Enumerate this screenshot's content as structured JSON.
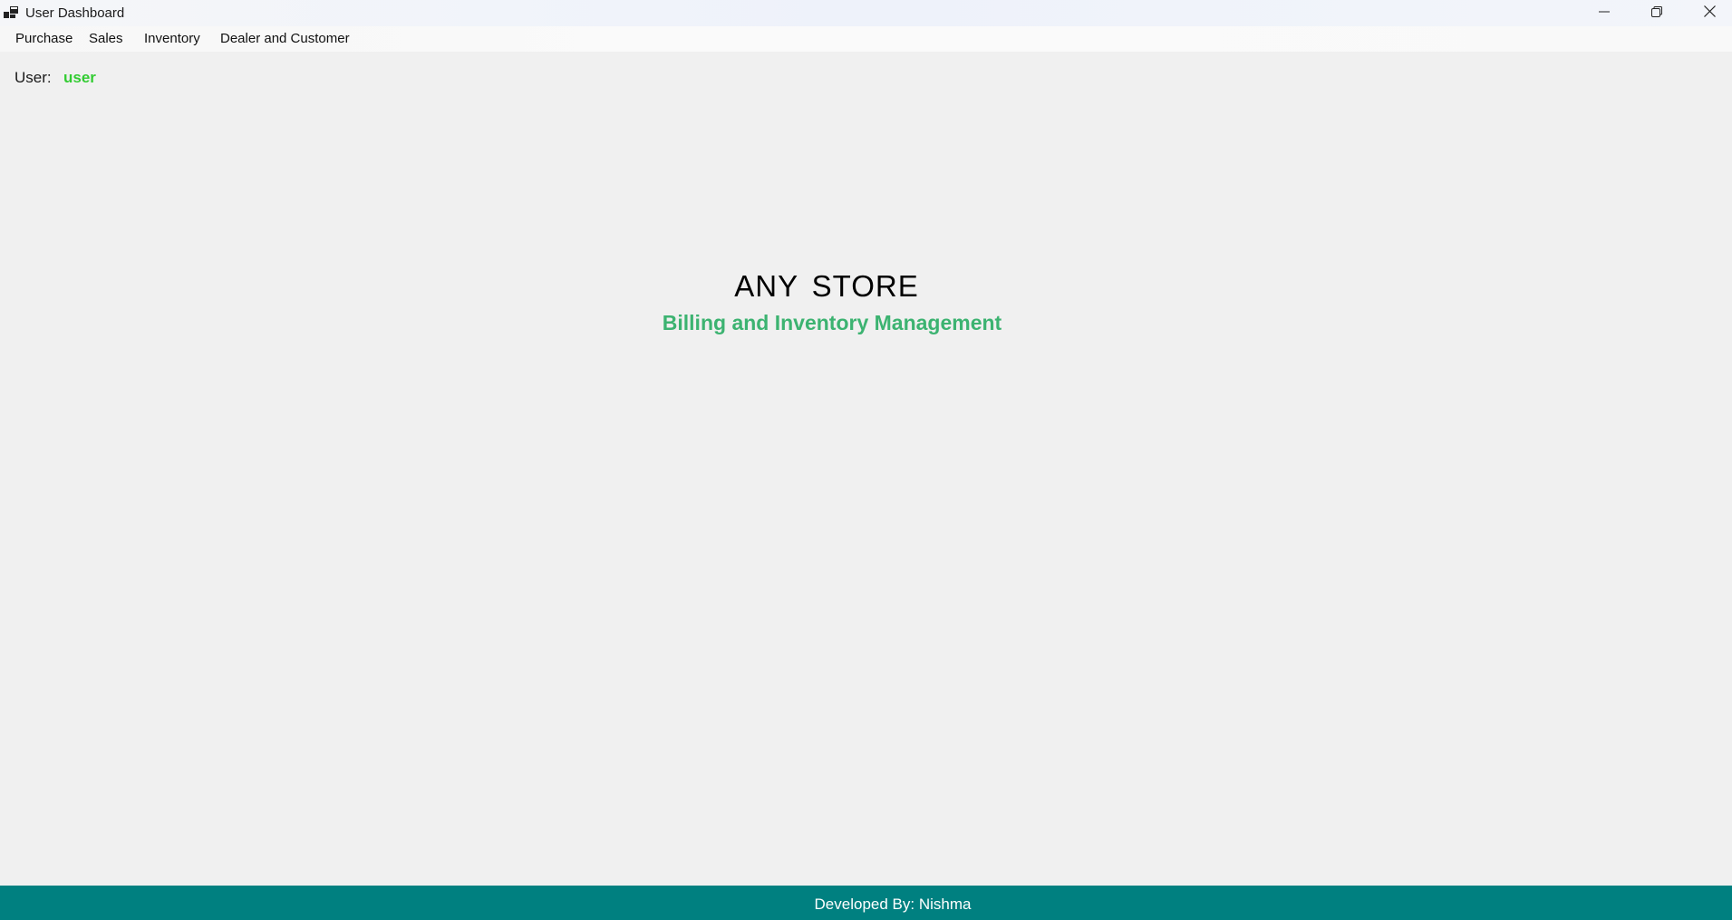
{
  "window": {
    "title": "User Dashboard",
    "icons": {
      "app": "app-window-icon",
      "minimize": "minimize-icon",
      "maximize": "restore-icon",
      "close": "close-icon"
    }
  },
  "menu": {
    "items": [
      {
        "label": "Purchase"
      },
      {
        "label": "Sales"
      },
      {
        "label": "Inventory"
      },
      {
        "label": "Dealer and Customer"
      }
    ]
  },
  "user": {
    "label": "User:",
    "name": "user"
  },
  "main": {
    "title": "ANY STORE",
    "subtitle": "Billing and Inventory Management"
  },
  "footer": {
    "text": "Developed By: Nishma"
  },
  "colors": {
    "background": "#f0f0f0",
    "footer": "#008080",
    "username": "#33cc33",
    "subtitle": "#3cb371"
  }
}
